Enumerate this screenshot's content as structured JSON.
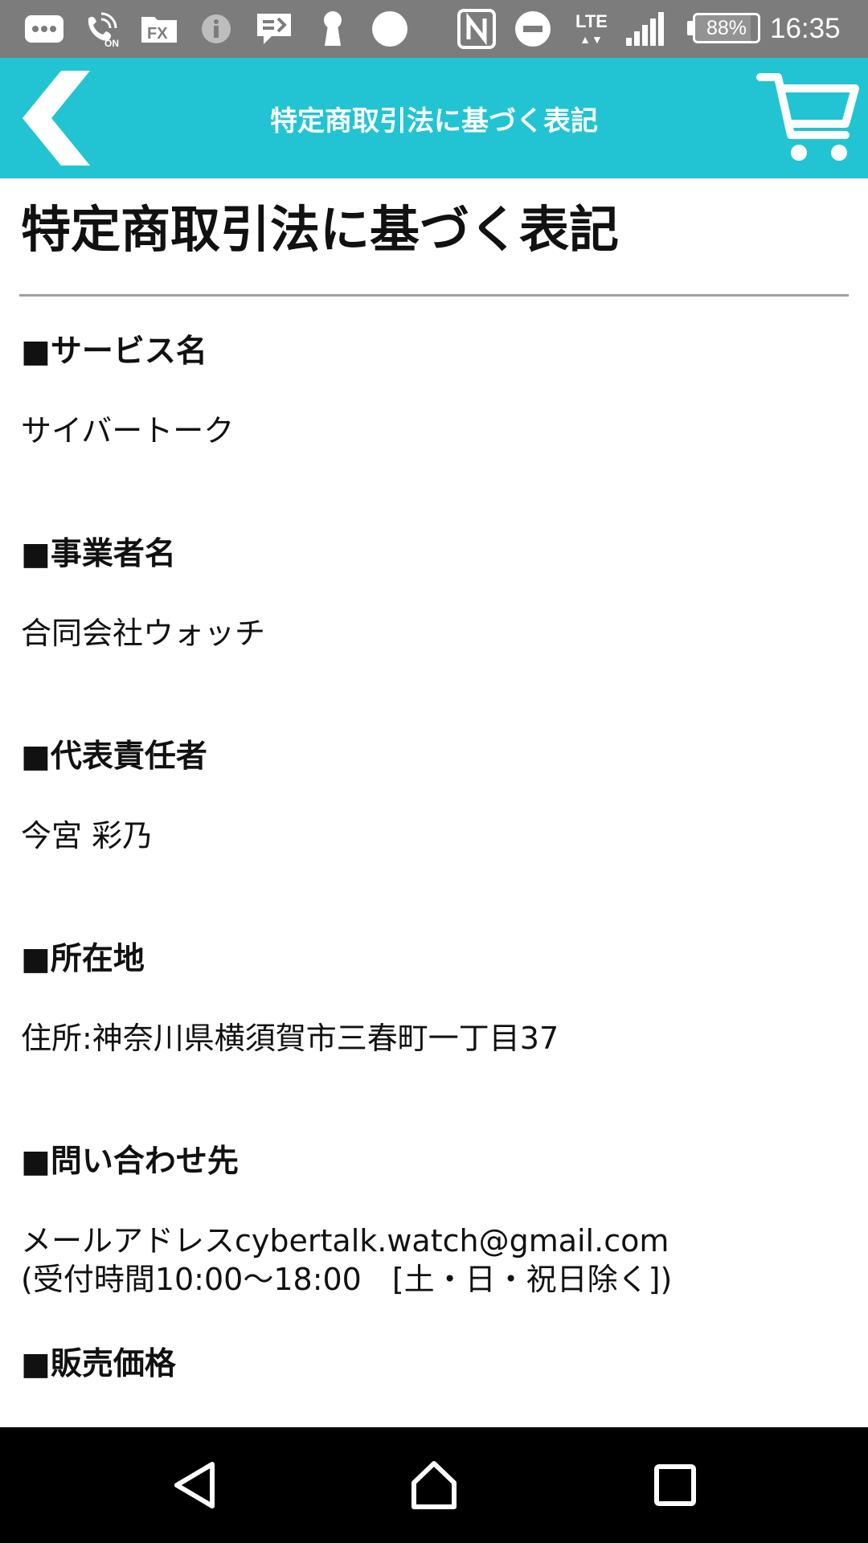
{
  "status_bar": {
    "icons": [
      "messaging-icon",
      "wifi-calling-on-icon",
      "fx-app-icon",
      "info-icon",
      "chat-icon",
      "keyhole-icon",
      "circle-icon",
      "nfc-icon",
      "do-not-disturb-icon",
      "lte-icon",
      "signal-icon",
      "battery-icon"
    ],
    "network": "LTE",
    "battery_percent": 88,
    "battery_label": "88%",
    "time": "16:35",
    "background_color": "#7c7c7c"
  },
  "header": {
    "title": "特定商取引法に基づく表記",
    "back_icon": "chevron-left-icon",
    "cart_icon": "cart-icon",
    "background_color": "#22c4d3"
  },
  "page": {
    "title": "特定商取引法に基づく表記",
    "sections": [
      {
        "heading": "■サービス名",
        "lines": [
          "サイバートーク"
        ]
      },
      {
        "heading": "■事業者名",
        "lines": [
          "合同会社ウォッチ"
        ]
      },
      {
        "heading": "■代表責任者",
        "lines": [
          "今宮 彩乃"
        ]
      },
      {
        "heading": "■所在地",
        "lines": [
          "住所:神奈川県横須賀市三春町一丁目37"
        ]
      },
      {
        "heading": "■問い合わせ先",
        "lines": [
          "メールアドレスcybertalk.watch@gmail.com",
          "(受付時間10:00〜18:00　[土・日・祝日除く])"
        ]
      },
      {
        "heading": "■販売価格",
        "lines": []
      }
    ]
  },
  "nav_bar": {
    "buttons": [
      "back-triangle-icon",
      "home-icon",
      "recents-square-icon"
    ]
  }
}
